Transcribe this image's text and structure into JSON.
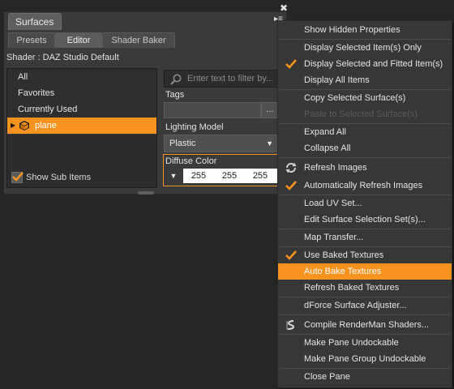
{
  "pane": {
    "title": "Surfaces",
    "close_glyph": "✖",
    "menu_glyph": "▸≡",
    "tabs": [
      "Presets",
      "Editor",
      "Shader Baker"
    ],
    "shader_label": "Shader : DAZ Studio Default",
    "list_items": [
      "All",
      "Favorites",
      "Currently Used"
    ],
    "selected_item": "plane",
    "show_sub_items": "Show Sub Items",
    "filter_placeholder": "Enter text to filter by...",
    "tags_label": "Tags",
    "tags_button": "...",
    "lighting_label": "Lighting Model",
    "lighting_value": "Plastic",
    "diffuse_label": "Diffuse Color",
    "diffuse_r": "255",
    "diffuse_g": "255",
    "diffuse_b": "255"
  },
  "menu": {
    "items": [
      "Show Hidden Properties",
      "Display Selected Item(s) Only",
      "Display Selected and Fitted Item(s)",
      "Display All Items",
      "Copy Selected Surface(s)",
      "Paste to Selected Surface(s)",
      "Expand All",
      "Collapse All",
      "Refresh Images",
      "Automatically Refresh Images",
      "Load UV Set...",
      "Edit Surface Selection Set(s)...",
      "Map Transfer...",
      "Use Baked Textures",
      "Auto Bake Textures",
      "Refresh Baked Textures",
      "dForce Surface Adjuster...",
      "Compile RenderMan Shaders...",
      "Make Pane Undockable",
      "Make Pane Group Undockable",
      "Close Pane"
    ]
  },
  "colors": {
    "accent": "#f7931e",
    "menu_bg": "#373737",
    "pane_bg": "#3a3a3a"
  },
  "icons": {
    "check": "check-icon",
    "refresh": "refresh-icon",
    "renderman": "renderman-icon",
    "cube": "cube-icon",
    "search": "search-icon"
  }
}
